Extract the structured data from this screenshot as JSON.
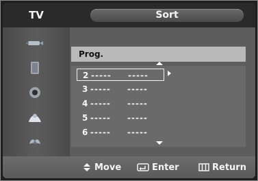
{
  "header": {
    "left_label": "TV",
    "title": "Sort"
  },
  "sidebar": {
    "icons": [
      "input-icon",
      "picture-icon",
      "sound-icon",
      "channel-icon",
      "setup-icon"
    ]
  },
  "panel": {
    "column_title": "Prog.",
    "rows": [
      {
        "num": "2",
        "col1": "-----",
        "col2": "-----",
        "selected": true
      },
      {
        "num": "3",
        "col1": "-----",
        "col2": "-----",
        "selected": false
      },
      {
        "num": "4",
        "col1": "-----",
        "col2": "-----",
        "selected": false
      },
      {
        "num": "5",
        "col1": "-----",
        "col2": "-----",
        "selected": false
      },
      {
        "num": "6",
        "col1": "-----",
        "col2": "-----",
        "selected": false
      }
    ]
  },
  "footer": {
    "move": "Move",
    "enter": "Enter",
    "return": "Return"
  }
}
